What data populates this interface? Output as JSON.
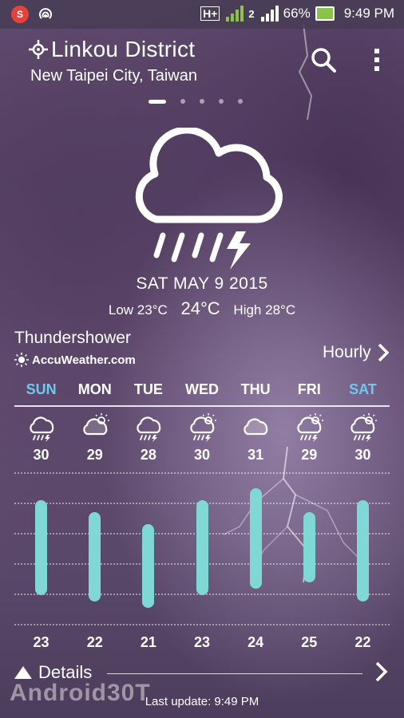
{
  "status_bar": {
    "network": "H+",
    "sim": "2",
    "battery": "66%",
    "time": "9:49 PM"
  },
  "header": {
    "city": "Linkou District",
    "region": "New Taipei City, Taiwan",
    "page_count": 5,
    "active_page": 0
  },
  "current": {
    "date": "SAT MAY 9 2015",
    "low_label": "Low 23°C",
    "temp": "24°C",
    "high_label": "High 28°C",
    "condition": "Thundershower",
    "provider": "AccuWeather.com",
    "hourly_label": "Hourly"
  },
  "forecast": {
    "days": [
      {
        "name": "SUN",
        "weekend": true,
        "icon": "thunderstorm-icon",
        "high": "30",
        "low": "23"
      },
      {
        "name": "MON",
        "weekend": false,
        "icon": "partly-cloudy-icon",
        "high": "29",
        "low": "22"
      },
      {
        "name": "TUE",
        "weekend": false,
        "icon": "thunderstorm-icon",
        "high": "28",
        "low": "21"
      },
      {
        "name": "WED",
        "weekend": false,
        "icon": "sun-thunderstorm-icon",
        "high": "30",
        "low": "23"
      },
      {
        "name": "THU",
        "weekend": false,
        "icon": "cloudy-icon",
        "high": "31",
        "low": "24"
      },
      {
        "name": "FRI",
        "weekend": false,
        "icon": "sun-thunderstorm-icon",
        "high": "29",
        "low": "25"
      },
      {
        "name": "SAT",
        "weekend": true,
        "icon": "sun-thunderstorm-icon",
        "high": "30",
        "low": "22"
      }
    ],
    "temp_range": [
      21,
      31
    ]
  },
  "footer": {
    "details_label": "Details",
    "last_update": "Last update: 9:49 PM",
    "watermark": "Android30T"
  },
  "colors": {
    "accent_weekend": "#6ec8f0",
    "bar": "#7fd8d4",
    "battery": "#8bc34a",
    "notification": "#e4433a"
  }
}
